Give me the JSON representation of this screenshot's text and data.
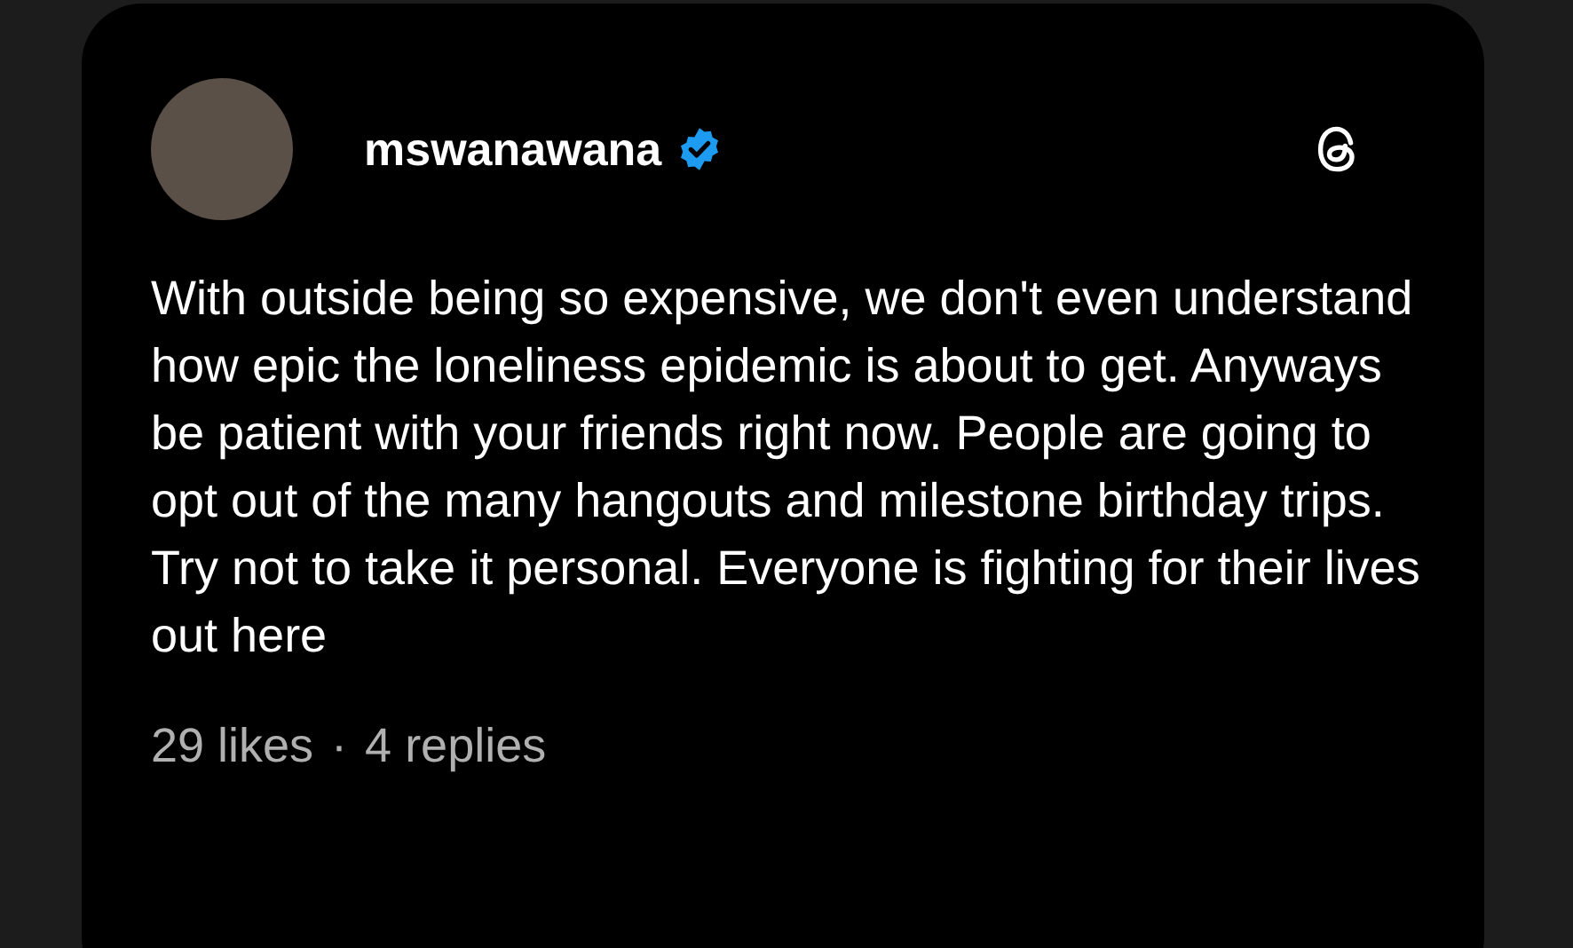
{
  "post": {
    "author": {
      "username": "mswanawana",
      "verified": true
    },
    "text": "With outside being so expensive, we don't even understand how epic the loneliness epidemic is about to get. Anyways be patient with your friends right now. People are going to opt out of the many hangouts and milestone birthday trips. Try not to take it personal. Everyone is fighting for their lives out here",
    "stats": {
      "likes": "29 likes",
      "separator": "·",
      "replies": "4 replies"
    }
  }
}
